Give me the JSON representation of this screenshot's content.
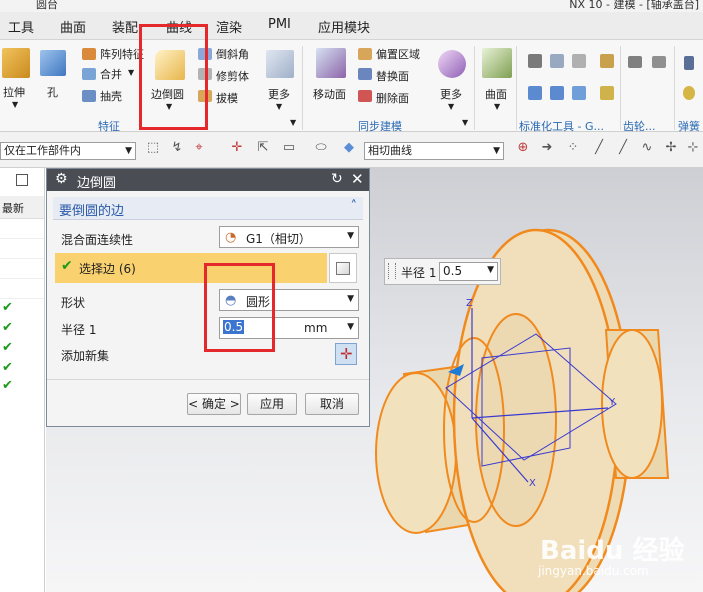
{
  "window": {
    "title_left": "圆台",
    "title_right": "NX 10 - 建模 - [轴承盖台]"
  },
  "menu": [
    "工具",
    "曲面",
    "装配",
    "曲线",
    "渲染",
    "PMI",
    "应用模块"
  ],
  "ribbon": {
    "btn_extrude": "拉伸",
    "btn_hole": "孔",
    "btn_pattern": "阵列特征",
    "btn_unite": "合并",
    "btn_shell": "抽壳",
    "btn_edge_blend": "边倒圆",
    "btn_chamfer": "倒斜角",
    "btn_trim_body": "修剪体",
    "btn_draft": "拔模",
    "btn_more1": "更多",
    "group_feature": "特征",
    "btn_move_face": "移动面",
    "btn_offset_region": "偏置区域",
    "btn_replace_face": "替换面",
    "btn_delete_face": "删除面",
    "btn_more2": "更多",
    "group_sync": "同步建模",
    "btn_surface": "曲面",
    "group_standard": "标准化工具 - G...",
    "group_gear": "齿轮...",
    "group_spring": "弹簧"
  },
  "toolbar2": {
    "filter_scope": "仅在工作部件内",
    "curve_rule": "相切曲线"
  },
  "leftpanel": {
    "header": "最新"
  },
  "dialog": {
    "title": "边倒圆",
    "section": "要倒圆的边",
    "continuity_label": "混合面连续性",
    "continuity_value": "G1（相切）",
    "select_edge": "选择边 (6)",
    "shape_label": "形状",
    "shape_value": "圆形",
    "radius_label": "半径 1",
    "radius_value": "0.5",
    "radius_unit": "mm",
    "add_new_set": "添加新集",
    "btn_ok": "< 确定 >",
    "btn_apply": "应用",
    "btn_cancel": "取消"
  },
  "radius_widget": {
    "label": "半径 1",
    "value": "0.5"
  },
  "axes": {
    "x": "X",
    "y": "Y",
    "z": "Z"
  },
  "watermark": {
    "brand": "Baidu 经验",
    "url": "jingyan.baidu.com"
  },
  "colors": {
    "highlight": "#e4282c",
    "dialog_title": "#4a4d54",
    "selected_row": "#f9d26f",
    "model_edge": "#f08a1e",
    "model_fill": "#ecd9b0"
  }
}
